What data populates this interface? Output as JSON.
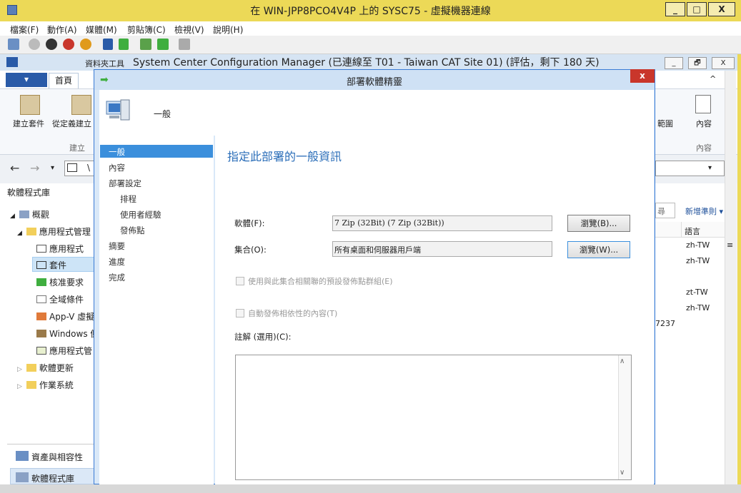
{
  "vm_window": {
    "title": "在 WIN-JPP8PCO4V4P 上的 SYSC75 - 虛擬機器連線",
    "controls": {
      "minimize": "_",
      "maximize": "□",
      "close": "X"
    },
    "menu": [
      "檔案(F)",
      "動作(A)",
      "媒體(M)",
      "剪貼簿(C)",
      "檢視(V)",
      "說明(H)"
    ]
  },
  "cm_window": {
    "title": "System Center Configuration Manager (已連線至 T01 - Taiwan CAT Site 01) (評估，剩下 180 天)",
    "folder_tools_tab": "資料夾工具",
    "controls": {
      "minimize": "_",
      "restore": "🗗",
      "close": "X"
    }
  },
  "ribbon": {
    "file_tab": "▾",
    "home_tab": "首頁",
    "buttons": [
      {
        "label": "建立套件"
      },
      {
        "label": "從定義建立"
      }
    ],
    "group_create": "建立",
    "right_button_label": "範圍",
    "properties_label": "內容",
    "properties_group": "內容",
    "collapse": "^"
  },
  "nav": {
    "back": "←",
    "forward": "→",
    "dropdown": "▾",
    "path_start": "\\"
  },
  "left_pane": {
    "title": "軟體程式庫",
    "tree": [
      {
        "label": "概觀",
        "level": 0,
        "expander": "◢"
      },
      {
        "label": "應用程式管理",
        "level": 1,
        "expander": "◢"
      },
      {
        "label": "應用程式",
        "level": 2
      },
      {
        "label": "套件",
        "level": 2,
        "selected": true
      },
      {
        "label": "核准要求",
        "level": 2
      },
      {
        "label": "全域條件",
        "level": 2
      },
      {
        "label": "App-V 虛擬",
        "level": 2
      },
      {
        "label": "Windows 側",
        "level": 2
      },
      {
        "label": "應用程式管",
        "level": 2
      },
      {
        "label": "軟體更新",
        "level": 1,
        "expander": "▷"
      },
      {
        "label": "作業系統",
        "level": 1,
        "expander": "▷"
      }
    ],
    "workspaces": [
      {
        "label": "資產與相容性"
      },
      {
        "label": "軟體程式庫"
      }
    ]
  },
  "right_pane": {
    "search_fragment": "尋",
    "add_criteria": "新增準則 ▾",
    "column_header": "語言",
    "rows": [
      "zh-TW",
      "zh-TW",
      "",
      "zt-TW",
      "zh-TW"
    ],
    "number_fragment": "7237",
    "menu_glyph": "≡"
  },
  "dialog": {
    "title": "部署軟體精靈",
    "close": "x",
    "header_text": "一般",
    "steps": [
      {
        "label": "一般",
        "sub": false,
        "selected": true
      },
      {
        "label": "內容",
        "sub": false
      },
      {
        "label": "部署設定",
        "sub": false
      },
      {
        "label": "排程",
        "sub": true
      },
      {
        "label": "使用者經驗",
        "sub": true
      },
      {
        "label": "發佈點",
        "sub": true
      },
      {
        "label": "摘要",
        "sub": false
      },
      {
        "label": "進度",
        "sub": false
      },
      {
        "label": "完成",
        "sub": false
      }
    ],
    "heading": "指定此部署的一般資訊",
    "software_label": "軟體(F):",
    "software_value": "7 Zip (32Bit) (7 Zip (32Bit))",
    "browse_software": "瀏覽(B)...",
    "collection_label": "集合(O):",
    "collection_value": "所有桌面和伺服器用戶端",
    "browse_collection": "瀏覽(W)...",
    "checkbox_default_dp_group": "使用與此集合相關聯的預設發佈點群組(E)",
    "checkbox_auto_distribute": "自動發佈相依性的內容(T)",
    "comment_label": "註解 (選用)(C):",
    "comment_value": "",
    "scroll_up": "∧",
    "scroll_down": "∨"
  }
}
